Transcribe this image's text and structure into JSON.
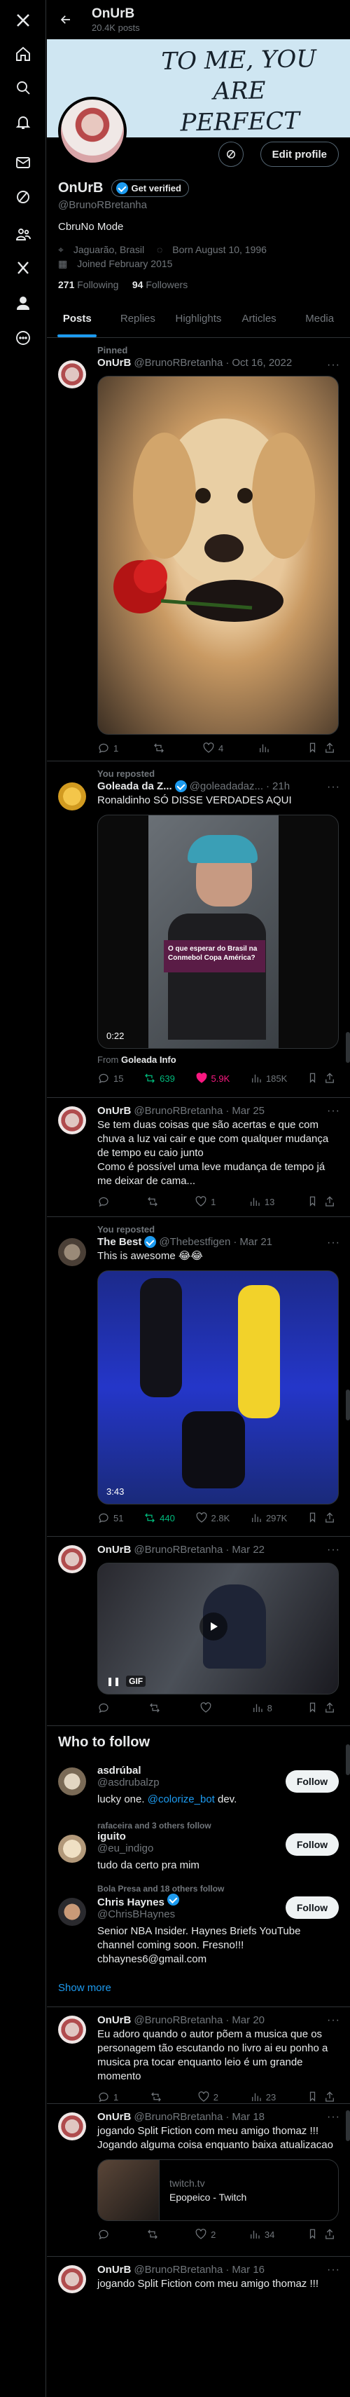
{
  "header": {
    "name": "OnUrB",
    "posts_count": "20.4K posts"
  },
  "banner": {
    "text_line1": "TO ME, YOU ARE",
    "text_line2": "PERFECT"
  },
  "profile": {
    "name": "OnUrB",
    "verify_label": "Get verified",
    "handle": "@BrunoRBretanha",
    "bio": "CbruNo Mode",
    "location": "Jaguarão, Brasil",
    "birthday": "Born August 10, 1996",
    "joined": "Joined February 2015",
    "following_count": "271",
    "following_label": "Following",
    "followers_count": "94",
    "followers_label": "Followers",
    "edit_label": "Edit profile"
  },
  "tabs": [
    "Posts",
    "Replies",
    "Highlights",
    "Articles",
    "Media"
  ],
  "tweets": [
    {
      "context": "Pinned",
      "name": "OnUrB",
      "handle": "@BrunoRBretanha",
      "time": "Oct 16, 2022",
      "text": "",
      "reply": "1",
      "retweet": "",
      "like": "4",
      "views": ""
    },
    {
      "context": "You reposted",
      "name": "Goleada da Z...",
      "handle": "@goleadadaz...",
      "time": "21h",
      "text": "Ronaldinho SÓ DISSE VERDADES AQUI",
      "video_time": "0:22",
      "video_caption": "O que esperar do Brasil na Conmebol Copa América?",
      "from_label": "From",
      "from_name": "Goleada Info",
      "reply": "15",
      "retweet": "639",
      "like": "5.9K",
      "views": "185K"
    },
    {
      "context": "",
      "name": "OnUrB",
      "handle": "@BrunoRBretanha",
      "time": "Mar 25",
      "text": "Se tem duas coisas que são acertas e que com chuva a luz vai cair e que com qualquer mudança de tempo eu caio junto\nComo é possível uma leve mudança de tempo já me deixar de cama...",
      "reply": "",
      "retweet": "",
      "like": "1",
      "views": "13"
    },
    {
      "context": "You reposted",
      "name": "The Best",
      "handle": "@Thebestfigen",
      "time": "Mar 21",
      "text": "This is awesome 😂😂",
      "video_time": "3:43",
      "reply": "51",
      "retweet": "440",
      "like": "2.8K",
      "views": "297K"
    },
    {
      "context": "",
      "name": "OnUrB",
      "handle": "@BrunoRBretanha",
      "time": "Mar 22",
      "text": "",
      "gif_label": "GIF",
      "reply": "",
      "retweet": "",
      "like": "",
      "views": "8"
    }
  ],
  "who_to_follow": {
    "title": "Who to follow",
    "follow_label": "Follow",
    "show_more": "Show more",
    "users": [
      {
        "context": "",
        "name": "asdrúbal",
        "handle": "@asdrubalzp",
        "desc_prefix": "lucky one. ",
        "desc_link": "@colorize_bot",
        "desc_suffix": " dev."
      },
      {
        "context": "rafaceira and 3 others follow",
        "name": "iguito",
        "handle": "@eu_indigo",
        "desc_prefix": "tudo da certo pra mim",
        "desc_link": "",
        "desc_suffix": ""
      },
      {
        "context": "Bola Presa and 18 others follow",
        "name": "Chris Haynes",
        "handle": "@ChrisBHaynes",
        "desc_prefix": "Senior NBA Insider. Haynes Briefs YouTube channel coming soon. Fresno!!! cbhaynes6@gmail.com",
        "desc_link": "",
        "desc_suffix": ""
      }
    ]
  },
  "tweets2": [
    {
      "name": "OnUrB",
      "handle": "@BrunoRBretanha",
      "time": "Mar 20",
      "text": "Eu adoro quando o autor põem a musica que os personagem tão escutando no livro ai eu ponho a musica pra tocar enquanto leio é um grande momento",
      "reply": "1",
      "retweet": "",
      "like": "2",
      "views": "23"
    },
    {
      "name": "OnUrB",
      "handle": "@BrunoRBretanha",
      "time": "Mar 18",
      "text": "jogando Split Fiction com meu amigo thomaz !!! Jogando alguma coisa enquanto baixa atualizacao",
      "card_domain": "twitch.tv",
      "card_title": "Epopeico - Twitch",
      "reply": "",
      "retweet": "",
      "like": "2",
      "views": "34"
    },
    {
      "name": "OnUrB",
      "handle": "@BrunoRBretanha",
      "time": "Mar 16",
      "text": "jogando Split Fiction com meu amigo thomaz !!!",
      "reply": "",
      "retweet": "",
      "like": "",
      "views": ""
    }
  ],
  "icons": [
    "x-logo-icon",
    "home-icon",
    "search-icon",
    "bell-icon",
    "mail-icon",
    "grok-icon",
    "communities-icon",
    "premium-x-icon",
    "profile-icon",
    "more-icon"
  ],
  "colors": {
    "accent": "#1d9bf0",
    "retweet": "#00ba7c",
    "like": "#f91880",
    "muted": "#71767b",
    "border": "#2f3336"
  }
}
